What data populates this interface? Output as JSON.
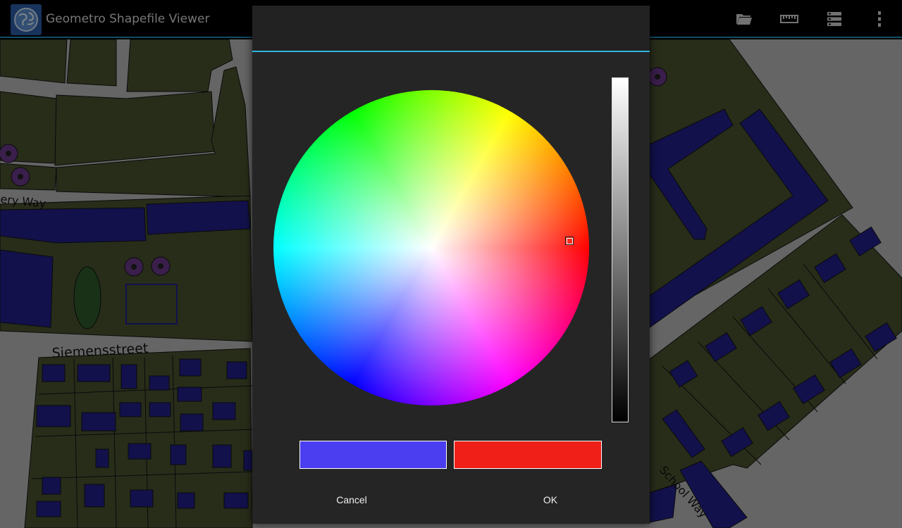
{
  "app": {
    "title": "Geometro Shapefile Viewer",
    "icon": "globe-icon"
  },
  "actionbar": {
    "actions": [
      {
        "name": "open-folder-icon"
      },
      {
        "name": "ruler-icon"
      },
      {
        "name": "layers-icon"
      },
      {
        "name": "overflow-menu-icon"
      }
    ]
  },
  "map": {
    "labels": {
      "street1": "ery Way",
      "street2": "Siemensstreet",
      "street3": "School Way"
    },
    "colors": {
      "background": "#b8b8b8",
      "parcel": "#4a5230",
      "building": "#22208a",
      "tree": "#6a3a8a",
      "pond": "#2e5a28"
    }
  },
  "color_picker": {
    "old_color": "#4a3ef0",
    "new_color": "#f02018",
    "cancel_label": "Cancel",
    "ok_label": "OK"
  }
}
